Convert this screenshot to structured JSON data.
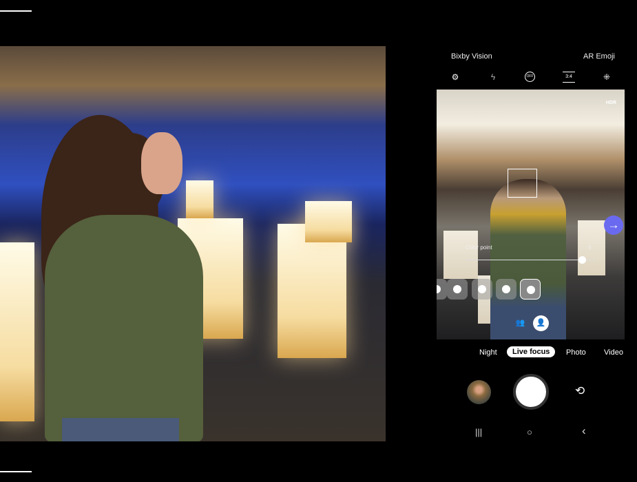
{
  "top_bar": {
    "left": "Bixby Vision",
    "right": "AR Emoji"
  },
  "toolbar": {
    "icons": [
      "settings-icon",
      "flash-off-icon",
      "timer-off-icon",
      "aspect-ratio-icon",
      "effects-icon"
    ],
    "aspect_label": "3:4",
    "timer_label": "OFF"
  },
  "viewfinder": {
    "hdr": "HDR",
    "effect_label": "Color point",
    "effect_value": "5",
    "slider_level": 0.9,
    "effects": [
      "blur",
      "big-circle",
      "spin",
      "color-point"
    ],
    "selected_effect": "color-point",
    "accent": "#6a6af0"
  },
  "modes": {
    "items": [
      "Night",
      "Live focus",
      "Photo",
      "Video"
    ],
    "selected": "Live focus"
  },
  "nav": {
    "recent": "|||",
    "home": "○",
    "back": "‹"
  }
}
